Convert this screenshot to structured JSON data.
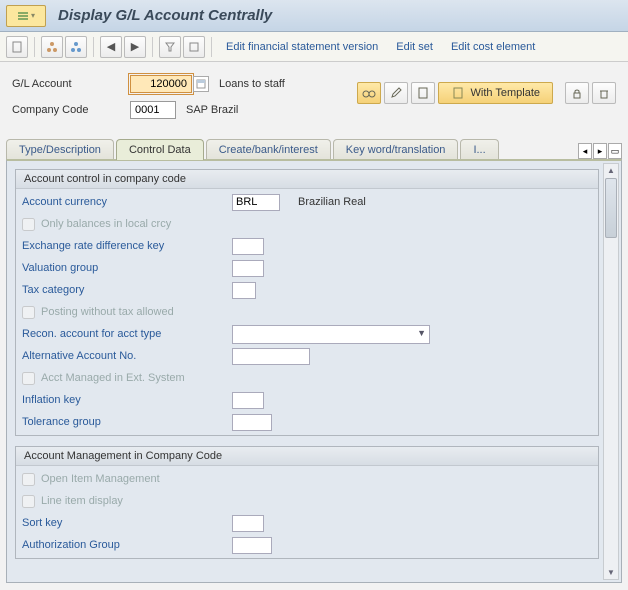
{
  "title": "Display G/L Account Centrally",
  "toolbar": {
    "edit_fsv": "Edit financial statement version",
    "edit_set": "Edit set",
    "edit_cost_element": "Edit cost element"
  },
  "header": {
    "gl_account_label": "G/L Account",
    "gl_account_value": "120000",
    "gl_account_desc": "Loans to staff",
    "company_code_label": "Company Code",
    "company_code_value": "0001",
    "company_code_desc": "SAP Brazil",
    "with_template": "With Template"
  },
  "tabs": {
    "t1": "Type/Description",
    "t2": "Control Data",
    "t3": "Create/bank/interest",
    "t4": "Key word/translation",
    "t5": "I..."
  },
  "group1": {
    "title": "Account control in company code",
    "account_currency_label": "Account currency",
    "account_currency_value": "BRL",
    "account_currency_desc": "Brazilian Real",
    "only_balances": "Only balances in local crcy",
    "exchange_rate_diff": "Exchange rate difference key",
    "valuation_group": "Valuation group",
    "tax_category": "Tax category",
    "posting_without_tax": "Posting without tax allowed",
    "recon_account": "Recon. account for acct type",
    "alternative_account": "Alternative Account No.",
    "acct_managed_ext": "Acct Managed in Ext. System",
    "inflation_key": "Inflation key",
    "tolerance_group": "Tolerance group"
  },
  "group2": {
    "title": "Account Management in Company Code",
    "open_item": "Open Item Management",
    "line_item": "Line item display",
    "sort_key": "Sort key",
    "auth_group": "Authorization Group"
  }
}
